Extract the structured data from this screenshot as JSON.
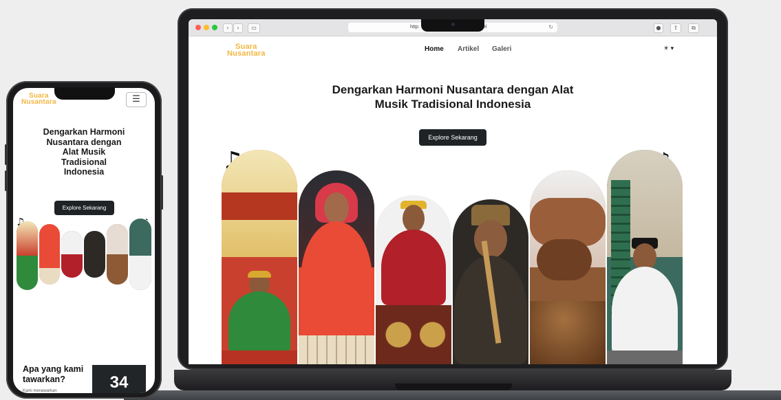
{
  "desktop": {
    "browser": {
      "url": "http:",
      "url_tail": "el"
    },
    "site": {
      "logo_line1": "Suara",
      "logo_line2": "Nusantara",
      "nav": [
        {
          "label": "Home",
          "active": true
        },
        {
          "label": "Artikel",
          "active": false
        },
        {
          "label": "Galeri",
          "active": false
        }
      ],
      "theme_toggle": "☀ ▾",
      "hero_title": "Dengarkan Harmoni Nusantara dengan Alat Musik Tradisional Indonesia",
      "cta_label": "Explore Sekarang"
    }
  },
  "mobile": {
    "logo_line1": "Suara",
    "logo_line2": "Nusantara",
    "menu_icon": "hamburger-icon",
    "hero_title": "Dengarkan Harmoni Nusantara dengan Alat Musik Tradisional Indonesia",
    "cta_label": "Explore Sekarang",
    "offer_title": "Apa yang kami tawarkan?",
    "offer_subtitle": "Kami menawarkan",
    "stat_value": "34"
  },
  "colors": {
    "logo": "#f2b640",
    "button": "#1f2326",
    "device_frame": "#1e1e20"
  }
}
